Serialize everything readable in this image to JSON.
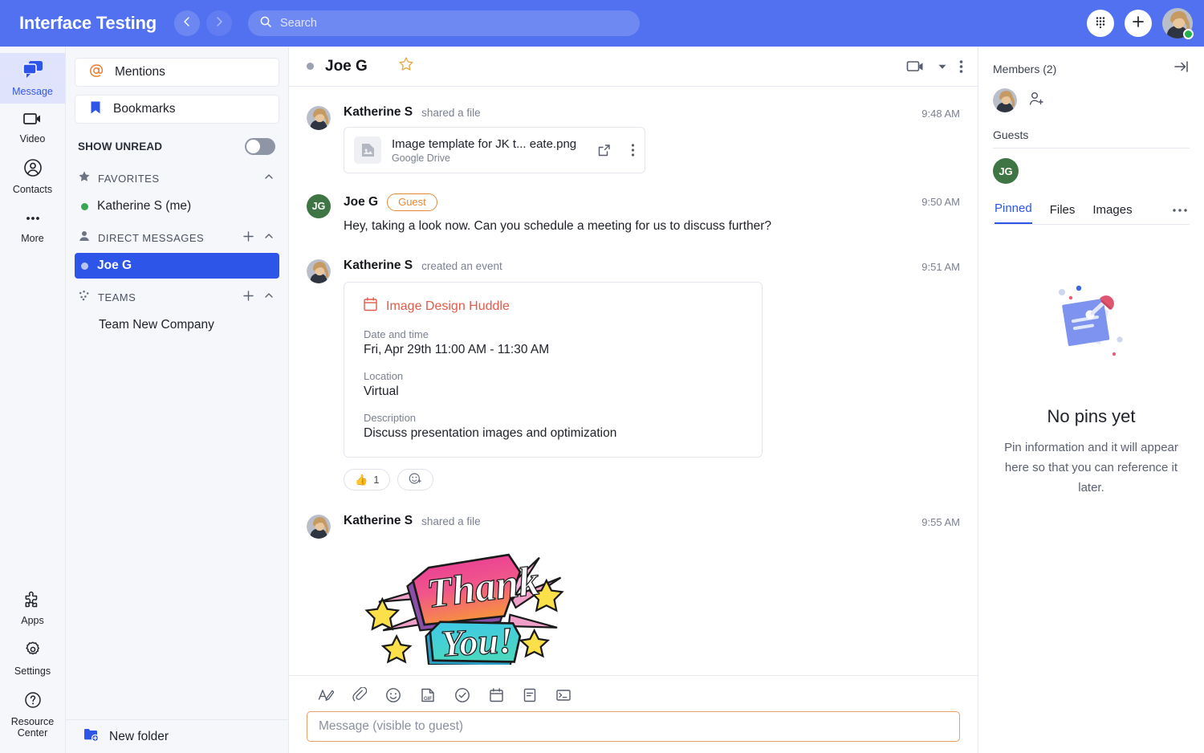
{
  "header": {
    "app_title": "Interface Testing",
    "back_icon": "chevron-left-icon",
    "forward_icon": "chevron-right-icon",
    "search_placeholder": "Search",
    "search_value": "",
    "dialpad_icon": "dialpad-icon",
    "plus_icon": "plus-icon",
    "avatar": "user-avatar",
    "brand_color": "#5271f0"
  },
  "rail": {
    "items": [
      {
        "label": "Message",
        "icon": "message-icon",
        "active": true
      },
      {
        "label": "Video",
        "icon": "video-icon",
        "active": false
      },
      {
        "label": "Contacts",
        "icon": "contacts-icon",
        "active": false
      },
      {
        "label": "More",
        "icon": "more-dots-icon",
        "active": false
      }
    ],
    "bottom_items": [
      {
        "label": "Apps",
        "icon": "apps-puzzle-icon"
      },
      {
        "label": "Settings",
        "icon": "gear-icon"
      },
      {
        "label": "Resource Center",
        "icon": "question-circle-icon"
      }
    ]
  },
  "sidebar": {
    "mentions_label": "Mentions",
    "mentions_icon": "at-mention-icon",
    "bookmarks_label": "Bookmarks",
    "bookmarks_icon": "bookmark-icon",
    "show_unread_label": "SHOW UNREAD",
    "show_unread_on": false,
    "sections": [
      {
        "title": "FAVORITES",
        "icon": "star-icon",
        "has_add": false,
        "items": [
          {
            "label": "Katherine S (me)",
            "status": "green",
            "selected": false
          }
        ]
      },
      {
        "title": "DIRECT MESSAGES",
        "icon": "person-icon",
        "has_add": true,
        "items": [
          {
            "label": "Joe G",
            "status": "grey",
            "selected": true
          }
        ]
      },
      {
        "title": "TEAMS",
        "icon": "teams-dots-icon",
        "has_add": true,
        "items": [
          {
            "label": "Team New Company",
            "status": "none",
            "selected": false
          }
        ]
      }
    ],
    "footer_label": "New folder",
    "footer_icon": "new-folder-icon"
  },
  "conversation": {
    "name": "Joe G",
    "status": "grey",
    "star_icon": "star-outline-icon",
    "video_icon": "video-call-icon",
    "chevron_icon": "chevron-down-icon",
    "more_icon": "more-vertical-icon",
    "messages": [
      {
        "author": "Katherine S",
        "subtitle": "shared a file",
        "time": "9:48 AM",
        "avatar_type": "photo",
        "type": "file",
        "file": {
          "name": "Image template for JK t... eate.png",
          "source": "Google Drive",
          "thumb_icon": "image-file-icon",
          "open_icon": "open-external-icon",
          "more_icon": "more-vertical-icon"
        }
      },
      {
        "author": "Joe G",
        "badge": "Guest",
        "time": "9:50 AM",
        "avatar_type": "initials",
        "avatar_initials": "JG",
        "type": "text",
        "text": "Hey, taking a look now. Can you schedule a meeting for us to discuss further?"
      },
      {
        "author": "Katherine S",
        "subtitle": "created an event",
        "time": "9:51 AM",
        "avatar_type": "photo",
        "type": "event",
        "event": {
          "title": "Image Design Huddle",
          "icon": "calendar-icon",
          "fields": [
            {
              "label": "Date and time",
              "value": "Fri, Apr 29th 11:00 AM - 11:30 AM"
            },
            {
              "label": "Location",
              "value": "Virtual"
            },
            {
              "label": "Description",
              "value": "Discuss presentation images and optimization"
            }
          ]
        },
        "reactions": [
          {
            "emoji": "👍",
            "count": "1"
          }
        ],
        "add_reaction_icon": "add-reaction-icon"
      },
      {
        "author": "Katherine S",
        "subtitle": "shared a file",
        "time": "9:55 AM",
        "avatar_type": "photo",
        "type": "image",
        "image_alt": "Thank You! graffiti art image"
      }
    ]
  },
  "composer": {
    "tools": [
      {
        "icon": "format-text-icon"
      },
      {
        "icon": "attachment-clip-icon"
      },
      {
        "icon": "emoji-icon"
      },
      {
        "icon": "gif-icon"
      },
      {
        "icon": "task-check-icon"
      },
      {
        "icon": "calendar-icon"
      },
      {
        "icon": "note-icon"
      },
      {
        "icon": "code-terminal-icon"
      }
    ],
    "placeholder": "Message (visible to guest)",
    "value": "",
    "border_color": "#e8a06a"
  },
  "right_panel": {
    "members_title": "Members (2)",
    "collapse_icon": "collapse-right-icon",
    "add_member_icon": "add-person-icon",
    "guests_label": "Guests",
    "guest_initials": "JG",
    "tabs": [
      {
        "label": "Pinned",
        "active": true
      },
      {
        "label": "Files",
        "active": false
      },
      {
        "label": "Images",
        "active": false
      }
    ],
    "tabs_more_icon": "more-horizontal-icon",
    "empty": {
      "illustration": "pinned-note-illustration",
      "title": "No pins yet",
      "subtitle": "Pin information and it will appear here so that you can reference it later."
    }
  }
}
